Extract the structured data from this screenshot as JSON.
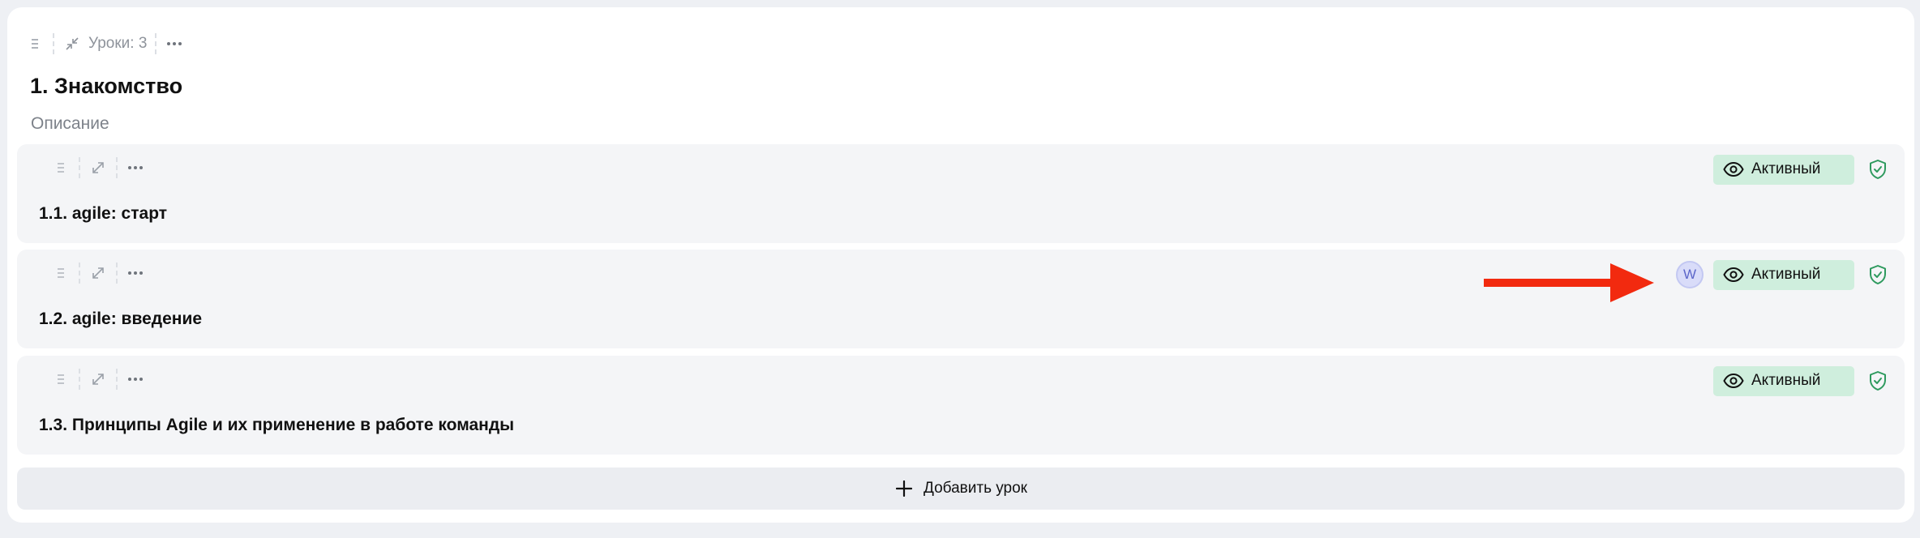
{
  "module": {
    "toolbar": {
      "lessons_count": "Уроки: 3"
    },
    "title": "1. Знакомство",
    "description": "Описание",
    "lessons": [
      {
        "title": "1.1. agile: старт",
        "status": "Активный",
        "avatar": null
      },
      {
        "title": "1.2. agile: введение",
        "status": "Активный",
        "avatar": "W"
      },
      {
        "title": "1.3. Принципы Agile и их применение в работе команды",
        "status": "Активный",
        "avatar": null
      }
    ],
    "add_lesson_label": "Добавить урок"
  },
  "colors": {
    "status_bg": "#cfeedd",
    "shield": "#2e9a5e",
    "avatar_bg": "#d9dcf9",
    "arrow": "#f22a0f"
  },
  "icons": {
    "drag": "drag-handle-icon",
    "collapse": "collapse-icon",
    "expand": "expand-icon",
    "more": "more-icon",
    "eye": "eye-icon",
    "shield": "shield-check-icon",
    "plus": "plus-icon"
  }
}
